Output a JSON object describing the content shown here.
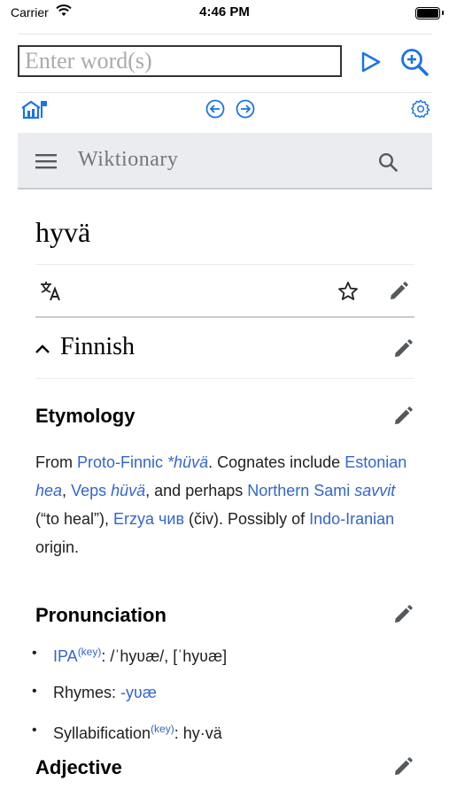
{
  "status_bar": {
    "carrier": "Carrier",
    "time": "4:46 PM"
  },
  "search": {
    "placeholder": "Enter word(s)",
    "value": ""
  },
  "wiki": {
    "site_title": "Wiktionary"
  },
  "page": {
    "title": "hyvä",
    "language_section": "Finnish",
    "etymology": {
      "heading": "Etymology",
      "parts": [
        {
          "t": "From ",
          "link": false,
          "italic": false
        },
        {
          "t": "Proto-Finnic ",
          "link": true,
          "italic": false
        },
        {
          "t": "*hüvä",
          "link": true,
          "italic": true
        },
        {
          "t": ". Cognates include ",
          "link": false,
          "italic": false
        },
        {
          "t": "Estonian ",
          "link": true,
          "italic": false
        },
        {
          "t": "hea",
          "link": true,
          "italic": true
        },
        {
          "t": ", ",
          "link": false,
          "italic": false
        },
        {
          "t": "Veps ",
          "link": true,
          "italic": false
        },
        {
          "t": "hüvä",
          "link": true,
          "italic": true
        },
        {
          "t": ", and perhaps ",
          "link": false,
          "italic": false
        },
        {
          "t": "Northern Sami ",
          "link": true,
          "italic": false
        },
        {
          "t": "savvit",
          "link": true,
          "italic": true
        },
        {
          "t": " (“to heal”), ",
          "link": false,
          "italic": false
        },
        {
          "t": "Erzya ",
          "link": true,
          "italic": false
        },
        {
          "t": "чив",
          "link": true,
          "italic": false
        },
        {
          "t": " (čiv). Possibly of ",
          "link": false,
          "italic": false
        },
        {
          "t": "Indo-Iranian",
          "link": true,
          "italic": false
        },
        {
          "t": " origin.",
          "link": false,
          "italic": false
        }
      ]
    },
    "pronunciation": {
      "heading": "Pronunciation",
      "ipa_label": "IPA",
      "key_label": "(key)",
      "ipa_value": ": /ˈhyʋæ/, [ˈhyʋæ]",
      "rhymes_label": "Rhymes: ",
      "rhymes_value": "-yʋæ",
      "syll_label": "Syllabification",
      "syll_value": ": hy·vä"
    },
    "adjective_heading": "Adjective"
  },
  "colors": {
    "accent": "#1a73e8",
    "link": "#3366cc",
    "header_bg": "#eaecf0"
  }
}
